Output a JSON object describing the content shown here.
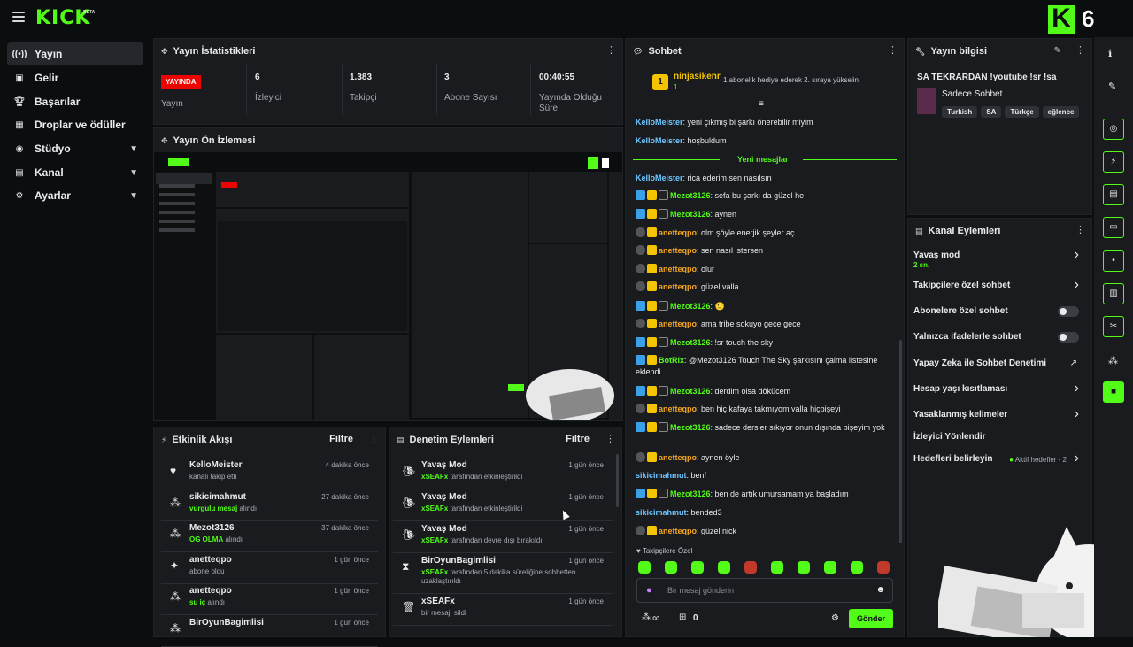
{
  "header": {
    "logo": "KICK",
    "beta": "BETA",
    "brand_letter": "K",
    "brand_number": "6"
  },
  "sidebar": {
    "items": [
      {
        "label": "Yayın",
        "icon": "broadcast-icon"
      },
      {
        "label": "Gelir",
        "icon": "revenue-icon"
      },
      {
        "label": "Başarılar",
        "icon": "trophy-icon"
      },
      {
        "label": "Droplar ve ödüller",
        "icon": "gift-icon"
      },
      {
        "label": "Stüdyo",
        "icon": "studio-icon"
      },
      {
        "label": "Kanal",
        "icon": "channel-icon"
      },
      {
        "label": "Ayarlar",
        "icon": "gear-icon"
      }
    ]
  },
  "stats": {
    "title": "Yayın İstatistikleri",
    "live_badge": "YAYINDA",
    "items": [
      {
        "value": "",
        "label": "Yayın"
      },
      {
        "value": "6",
        "label": "İzleyici"
      },
      {
        "value": "1.383",
        "label": "Takipçi"
      },
      {
        "value": "3",
        "label": "Abone Sayısı"
      },
      {
        "value": "00:40:55",
        "label": "Yayında Olduğu Süre"
      }
    ]
  },
  "preview": {
    "title": "Yayın Ön İzlemesi"
  },
  "activity": {
    "title": "Etkinlik Akışı",
    "filter": "Filtre",
    "rows": [
      {
        "icon": "heart-icon",
        "name": "KelloMeister",
        "sub_pre": "",
        "sub_hl": "",
        "sub": "kanalı takip etti",
        "time": "4 dakika önce"
      },
      {
        "icon": "people-icon",
        "name": "sikicimahmut",
        "sub_pre": "",
        "sub_hl": "vurgulu mesaj",
        "sub": " alındı",
        "time": "27 dakika önce"
      },
      {
        "icon": "people-icon",
        "name": "Mezot3126",
        "sub_pre": "",
        "sub_hl": "OG OLMA",
        "sub": " alındı",
        "time": "37 dakika önce"
      },
      {
        "icon": "sparkle-icon",
        "name": "anetteqpo",
        "sub_pre": "",
        "sub_hl": "",
        "sub": "abone oldu",
        "time": "1 gün önce"
      },
      {
        "icon": "people-icon",
        "name": "anetteqpo",
        "sub_pre": "",
        "sub_hl": "su iç",
        "sub": " alındı",
        "time": "1 gün önce"
      },
      {
        "icon": "people-icon",
        "name": "BirOyunBagimlisi",
        "sub_pre": "",
        "sub_hl": "",
        "sub": "",
        "time": "1 gün önce"
      }
    ]
  },
  "moderation": {
    "title": "Denetim Eylemleri",
    "filter": "Filtre",
    "rows": [
      {
        "icon": "snail-icon",
        "name": "Yavaş Mod",
        "sub_hl": "xSEAFx",
        "sub": " tarafından etkinleştirildi",
        "time": "1 gün önce"
      },
      {
        "icon": "snail-icon",
        "name": "Yavaş Mod",
        "sub_hl": "xSEAFx",
        "sub": " tarafından etkinleştirildi",
        "time": "1 gün önce"
      },
      {
        "icon": "snail-icon",
        "name": "Yavaş Mod",
        "sub_hl": "xSEAFx",
        "sub": " tarafından devre dışı bırakıldı",
        "time": "1 gün önce"
      },
      {
        "icon": "hourglass-icon",
        "name": "BirOyunBagimlisi",
        "sub_hl": "xSEAFx",
        "sub": " tarafından 5 dakika süreliğine sohbetten uzaklaştırıldı",
        "time": "1 gün önce"
      },
      {
        "icon": "trash-icon",
        "name": "xSEAFx",
        "sub_hl": "",
        "sub": "bir mesajı sildi",
        "time": "1 gün önce"
      }
    ]
  },
  "chat": {
    "title": "Sohbet",
    "pinned_user": "ninjasikenr",
    "pinned_count": "1",
    "pinned_text": "1 abonelik hediye ederek 2. sıraya yükselin",
    "new_messages": "Yeni mesajlar",
    "messages": [
      {
        "user": "KelloMeister",
        "color": "blue",
        "badges": [],
        "text": ": yeni çıkmış bi şarkı önerebilir miyim"
      },
      {
        "user": "KelloMeister",
        "color": "blue",
        "badges": [],
        "text": ": hoşbuldum"
      },
      {
        "user": "KelloMeister",
        "color": "blue",
        "badges": [],
        "text": ": rica ederim sen nasılsın"
      },
      {
        "user": "Mezot3126",
        "color": "green",
        "badges": [
          "b",
          "y",
          "k"
        ],
        "text": ": sefa bu şarkı da güzel he"
      },
      {
        "user": "Mezot3126",
        "color": "green",
        "badges": [
          "b",
          "y",
          "k"
        ],
        "text": ": aynen"
      },
      {
        "user": "anetteqpo",
        "color": "orange",
        "badges": [
          "s",
          "y"
        ],
        "text": ": olm şöyle enerjik şeyler aç"
      },
      {
        "user": "anetteqpo",
        "color": "orange",
        "badges": [
          "s",
          "y"
        ],
        "text": ": sen nasıl istersen"
      },
      {
        "user": "anetteqpo",
        "color": "orange",
        "badges": [
          "s",
          "y"
        ],
        "text": ": olur"
      },
      {
        "user": "anetteqpo",
        "color": "orange",
        "badges": [
          "s",
          "y"
        ],
        "text": ": güzel valla"
      },
      {
        "user": "Mezot3126",
        "color": "green",
        "badges": [
          "b",
          "y",
          "k"
        ],
        "text": ": 🙂"
      },
      {
        "user": "anetteqpo",
        "color": "orange",
        "badges": [
          "s",
          "y"
        ],
        "text": ": ama tribe sokuyo gece gece"
      },
      {
        "user": "Mezot3126",
        "color": "green",
        "badges": [
          "b",
          "y",
          "k"
        ],
        "text": ": !sr touch the sky"
      },
      {
        "user": "BotRix",
        "color": "green",
        "badges": [
          "b",
          "y"
        ],
        "text": ": @Mezot3126 Touch The Sky şarkısını çalma listesine eklendi."
      },
      {
        "user": "Mezot3126",
        "color": "green",
        "badges": [
          "b",
          "y",
          "k"
        ],
        "text": ": derdim olsa dökücem"
      },
      {
        "user": "anetteqpo",
        "color": "orange",
        "badges": [
          "s",
          "y"
        ],
        "text": ": ben hiç kafaya takmıyom valla hiçbişeyi"
      },
      {
        "user": "Mezot3126",
        "color": "green",
        "badges": [
          "b",
          "y",
          "k"
        ],
        "text": ": sadece dersler sıkıyor onun dışında bişeyim yok"
      },
      {
        "user": "anetteqpo",
        "color": "orange",
        "badges": [
          "s",
          "y"
        ],
        "text": ": aynen öyle"
      },
      {
        "user": "sikicimahmut",
        "color": "blue",
        "badges": [],
        "text": ": benf"
      },
      {
        "user": "Mezot3126",
        "color": "green",
        "badges": [
          "b",
          "y",
          "k"
        ],
        "text": ": ben de artık umursamam ya başladım"
      },
      {
        "user": "sikicimahmut",
        "color": "blue",
        "badges": [],
        "text": ": bended3"
      },
      {
        "user": "anetteqpo",
        "color": "orange",
        "badges": [
          "s",
          "y"
        ],
        "text": ": güzel nick"
      }
    ],
    "followers_only": "Takipçilere Özel",
    "input_placeholder": "Bir mesaj gönderin",
    "infinity": "∞",
    "count": "0",
    "send": "Gönder"
  },
  "stream_info": {
    "title": "Yayın bilgisi",
    "stream_title": "SA TEKRARDAN !youtube !sr !sa",
    "category": "Sadece Sohbet",
    "tags": [
      "Turkish",
      "SA",
      "Türkçe",
      "eğlence"
    ]
  },
  "channel_actions": {
    "title": "Kanal Eylemleri",
    "items": [
      {
        "label": "Yavaş mod",
        "sub": "2 sn.",
        "kind": "chevron"
      },
      {
        "label": "Takipçilere özel sohbet",
        "sub": "",
        "kind": "chevron"
      },
      {
        "label": "Abonelere özel sohbet",
        "sub": "",
        "kind": "toggle"
      },
      {
        "label": "Yalnızca ifadelerle sohbet",
        "sub": "",
        "kind": "toggle"
      },
      {
        "label": "Yapay Zeka ile Sohbet Denetimi",
        "sub": "",
        "kind": "external"
      },
      {
        "label": "Hesap yaşı kısıtlaması",
        "sub": "",
        "kind": "chevron"
      },
      {
        "label": "Yasaklanmış kelimeler",
        "sub": "",
        "kind": "chevron"
      },
      {
        "label": "İzleyici Yönlendir",
        "sub": "",
        "kind": "none"
      },
      {
        "label": "Hedefleri belirleyin",
        "sub": "",
        "kind": "chevron",
        "extra": "Aktif hedefler - 2"
      }
    ]
  },
  "colors": {
    "accent": "#53fc18",
    "live": "#eb0400",
    "panel": "#191b1f",
    "bg": "#0b0e0f"
  }
}
